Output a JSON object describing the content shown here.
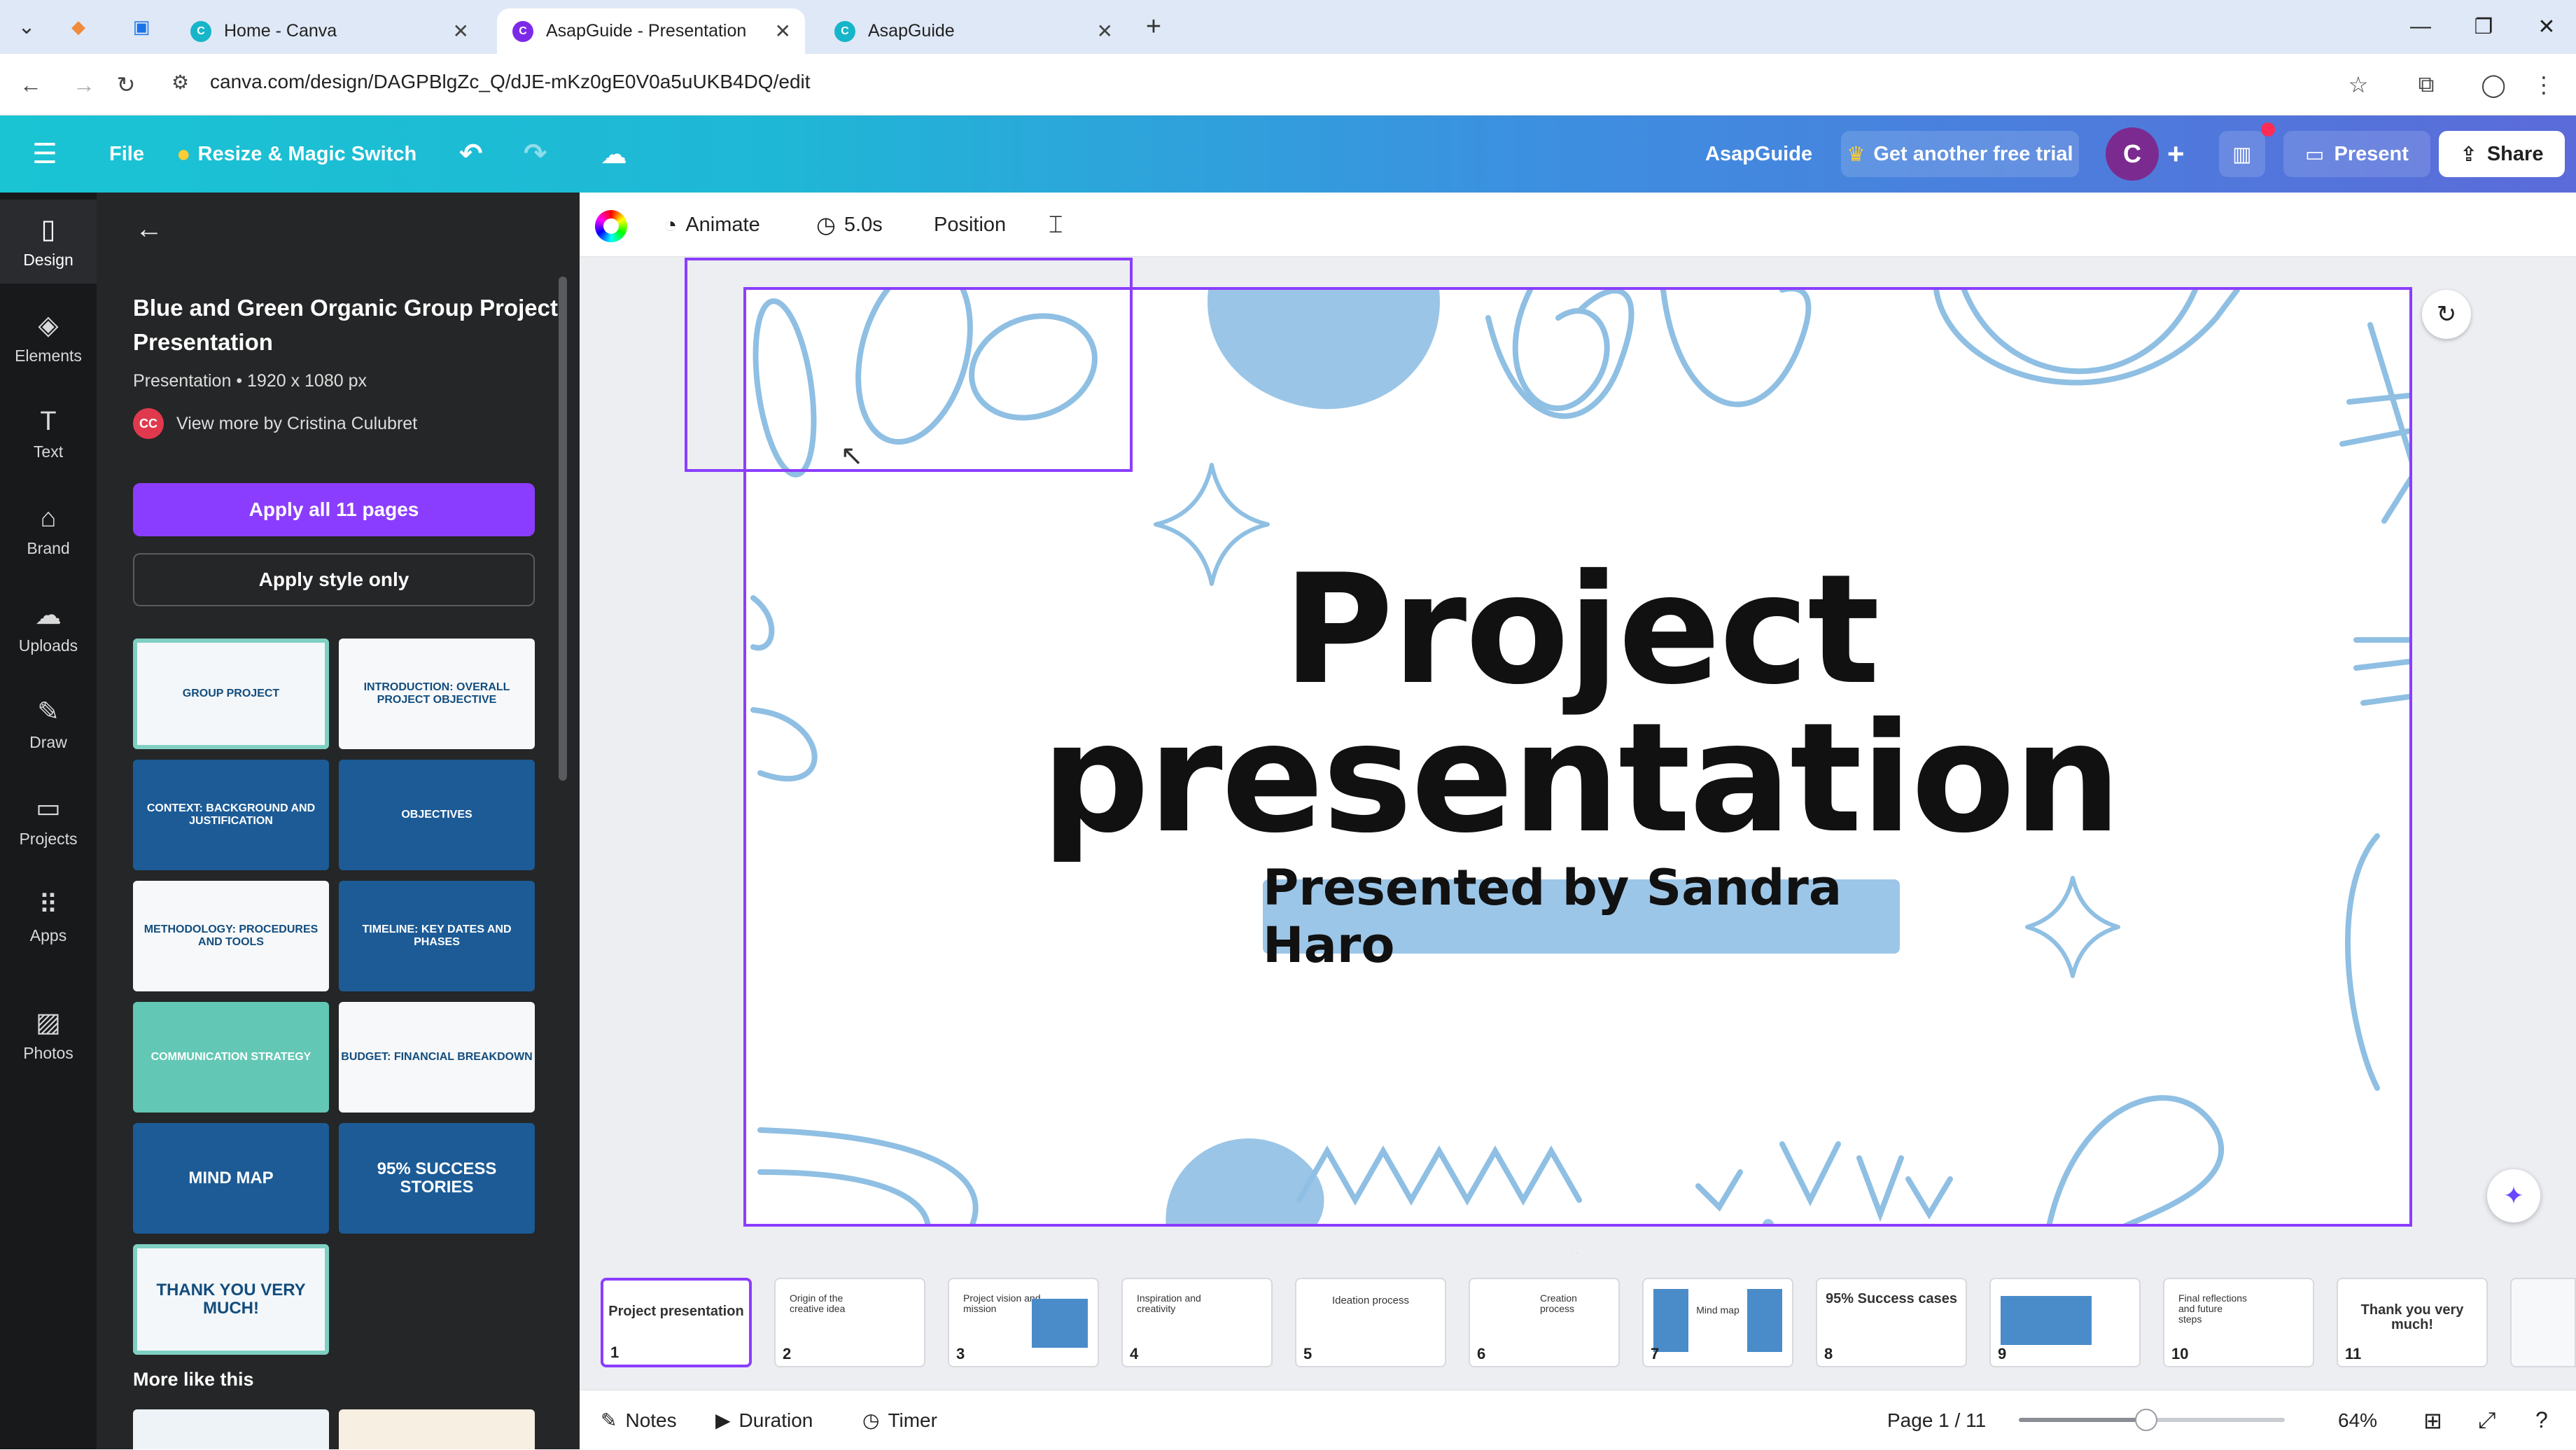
{
  "browser": {
    "tabs": [
      {
        "title": "Home - Canva",
        "active": false
      },
      {
        "title": "AsapGuide - Presentation",
        "active": true
      },
      {
        "title": "AsapGuide",
        "active": false
      }
    ],
    "url": "canva.com/design/DAGPBlgZc_Q/dJE-mKz0gE0V0a5uUKB4DQ/edit"
  },
  "topbar": {
    "file_label": "File",
    "resize_label": "Resize & Magic Switch",
    "design_name": "AsapGuide",
    "trial_label": "Get another free trial",
    "avatar_initial": "C",
    "present_label": "Present",
    "share_label": "Share",
    "gradient_start": "#1ac4d3",
    "gradient_end": "#5b6bd9"
  },
  "rail": {
    "items": [
      {
        "label": "Design",
        "icon": "design-icon"
      },
      {
        "label": "Elements",
        "icon": "elements-icon"
      },
      {
        "label": "Text",
        "icon": "text-icon"
      },
      {
        "label": "Brand",
        "icon": "brand-icon"
      },
      {
        "label": "Uploads",
        "icon": "upload-icon"
      },
      {
        "label": "Draw",
        "icon": "draw-icon"
      },
      {
        "label": "Projects",
        "icon": "folder-icon"
      },
      {
        "label": "Apps",
        "icon": "apps-icon"
      },
      {
        "label": "Photos",
        "icon": "photos-icon"
      }
    ]
  },
  "panel": {
    "title": "Blue and Green Organic Group Project Presentation",
    "meta": "Presentation • 1920 x 1080 px",
    "author_initials": "CC",
    "author_link": "View more by Cristina Culubret",
    "apply_all": "Apply all 11 pages",
    "apply_style": "Apply style only",
    "templates": [
      {
        "label": "GROUP PROJECT",
        "style": "light"
      },
      {
        "label": "INTRODUCTION: OVERALL PROJECT OBJECTIVE",
        "style": "white"
      },
      {
        "label": "CONTEXT: BACKGROUND AND JUSTIFICATION",
        "style": "blue"
      },
      {
        "label": "OBJECTIVES",
        "style": "blue"
      },
      {
        "label": "METHODOLOGY: PROCEDURES AND TOOLS",
        "style": "white"
      },
      {
        "label": "TIMELINE: KEY DATES AND PHASES",
        "style": "blue"
      },
      {
        "label": "COMMUNICATION STRATEGY",
        "style": "teal"
      },
      {
        "label": "BUDGET: FINANCIAL BREAKDOWN",
        "style": "white"
      },
      {
        "label": "MIND MAP",
        "style": "blue"
      },
      {
        "label": "95% SUCCESS STORIES",
        "style": "blue"
      },
      {
        "label": "THANK YOU VERY MUCH!",
        "style": "light"
      }
    ],
    "more_like_this": "More like this"
  },
  "context_bar": {
    "animate_label": "Animate",
    "duration_label": "5.0s",
    "position_label": "Position"
  },
  "slide": {
    "title_line1": "Project",
    "title_line2": "presentation",
    "subtitle": "Presented by Sandra Haro",
    "accent_color": "#9cc6e8",
    "doodle_color": "#8fbfe3"
  },
  "filmstrip": {
    "pages": [
      {
        "num": "1",
        "label": "Project presentation",
        "active": true
      },
      {
        "num": "2",
        "label": "Origin of the creative idea"
      },
      {
        "num": "3",
        "label": "Project vision and mission"
      },
      {
        "num": "4",
        "label": "Inspiration and creativity"
      },
      {
        "num": "5",
        "label": "Ideation process"
      },
      {
        "num": "6",
        "label": "Creation process"
      },
      {
        "num": "7",
        "label": "Mind map"
      },
      {
        "num": "8",
        "label": "95% Success cases"
      },
      {
        "num": "9",
        "label": ""
      },
      {
        "num": "10",
        "label": "Final reflections and future steps"
      },
      {
        "num": "11",
        "label": "Thank you very much!"
      }
    ]
  },
  "bottombar": {
    "notes_label": "Notes",
    "duration_label": "Duration",
    "timer_label": "Timer",
    "page_indicator": "Page 1 / 11",
    "zoom_label": "64%",
    "zoom_fraction": 0.48
  }
}
